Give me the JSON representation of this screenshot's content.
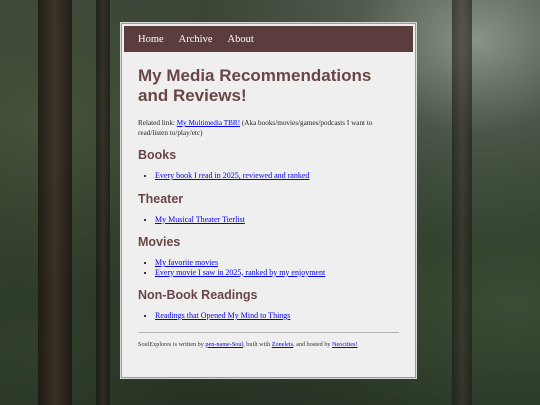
{
  "nav": {
    "items": [
      "Home",
      "Archive",
      "About"
    ]
  },
  "main": {
    "title": "My Media Recommendations and Reviews!",
    "related_prefix": "Related link:",
    "related_link": "My Multimedia TBR!",
    "related_suffix": " (Aka books/movies/games/podcasts I want to read/listen to/play/etc)"
  },
  "sections": [
    {
      "heading": "Books",
      "links": [
        "Every book I read in 2025, reviewed and ranked"
      ]
    },
    {
      "heading": "Theater",
      "links": [
        "My Musical Theater Tierlist"
      ]
    },
    {
      "heading": "Movies",
      "links": [
        "My favorite movies",
        "Every movie I saw in 2025, ranked by my enjoyment"
      ]
    },
    {
      "heading": "Non-Book Readings",
      "links": [
        "Readings that Opened My Mind to Things"
      ]
    }
  ],
  "footer": {
    "prefix": "SoulExplores is written by ",
    "author_link": "pen-name-Soul",
    "mid1": ", built with ",
    "builder_link": "Zonelets",
    "mid2": ", and hosted by ",
    "host_link": "Neocities!"
  }
}
